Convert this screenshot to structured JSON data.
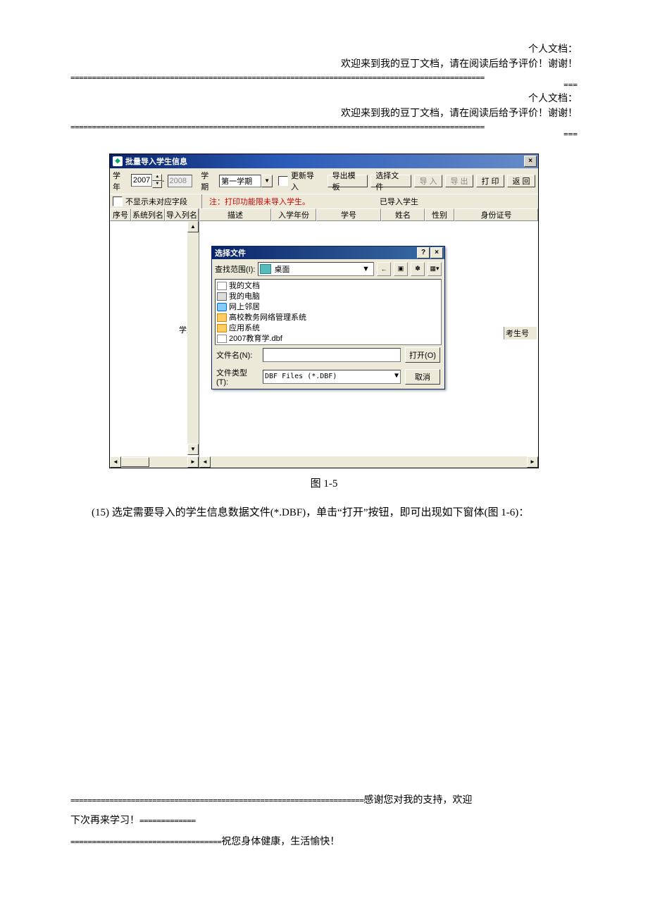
{
  "header": {
    "line1": "个人文档：",
    "line2": "欢迎来到我的豆丁文档，请在阅读后给予评价！谢谢！",
    "sep": "================================================================================================",
    "sep_end": "==="
  },
  "app": {
    "title": "批量导入学生信息",
    "toolbar": {
      "year_label": "学年",
      "year_from": "2007",
      "year_to": "2008",
      "semester_label": "学期",
      "semester_value": "第一学期",
      "reimport_label": "更新导入",
      "export_template": "导出模板",
      "select_file": "选择文件",
      "import": "导 入",
      "export": "导 出",
      "print": "打 印",
      "back": "返 回"
    },
    "subhead": {
      "left_check_label": "不显示未对应字段",
      "note": "注：打印功能限未导入学生。",
      "right_label": "已导入学生"
    },
    "left_cols": [
      "序号",
      "系统列名",
      "导入列名"
    ],
    "right_cols": [
      "描述",
      "入学年份",
      "学号",
      "姓名",
      "性别",
      "身份证号"
    ],
    "student_label": "学生",
    "exam_id_label": "考生号"
  },
  "dialog": {
    "title": "选择文件",
    "look_label": "查找范围(I):",
    "look_value": "桌面",
    "items": [
      {
        "icon": "doc",
        "name": "我的文档"
      },
      {
        "icon": "drive",
        "name": "我的电脑"
      },
      {
        "icon": "net",
        "name": "网上邻居"
      },
      {
        "icon": "folder",
        "name": "高校教务网络管理系统"
      },
      {
        "icon": "folder",
        "name": "应用系统"
      },
      {
        "icon": "doc",
        "name": "2007教育学.dbf"
      }
    ],
    "filename_label": "文件名(N):",
    "filename_value": "",
    "filetype_label": "文件类型(T):",
    "filetype_value": "DBF Files (*.DBF)",
    "open": "打开(O)",
    "cancel": "取消"
  },
  "caption": "图 1-5",
  "paragraph": "(15) 选定需要导入的学生信息数据文件(*.DBF)，单击“打开”按钮，即可出现如下窗体(图 1-6)：",
  "footer": {
    "eq_long": "====================================================================",
    "text1": "感谢您对我的支持，欢迎",
    "text2": "下次再来学习！",
    "eq_mid": "=============",
    "eq_short": "===================================",
    "text3": "祝您身体健康，生活愉快！"
  }
}
